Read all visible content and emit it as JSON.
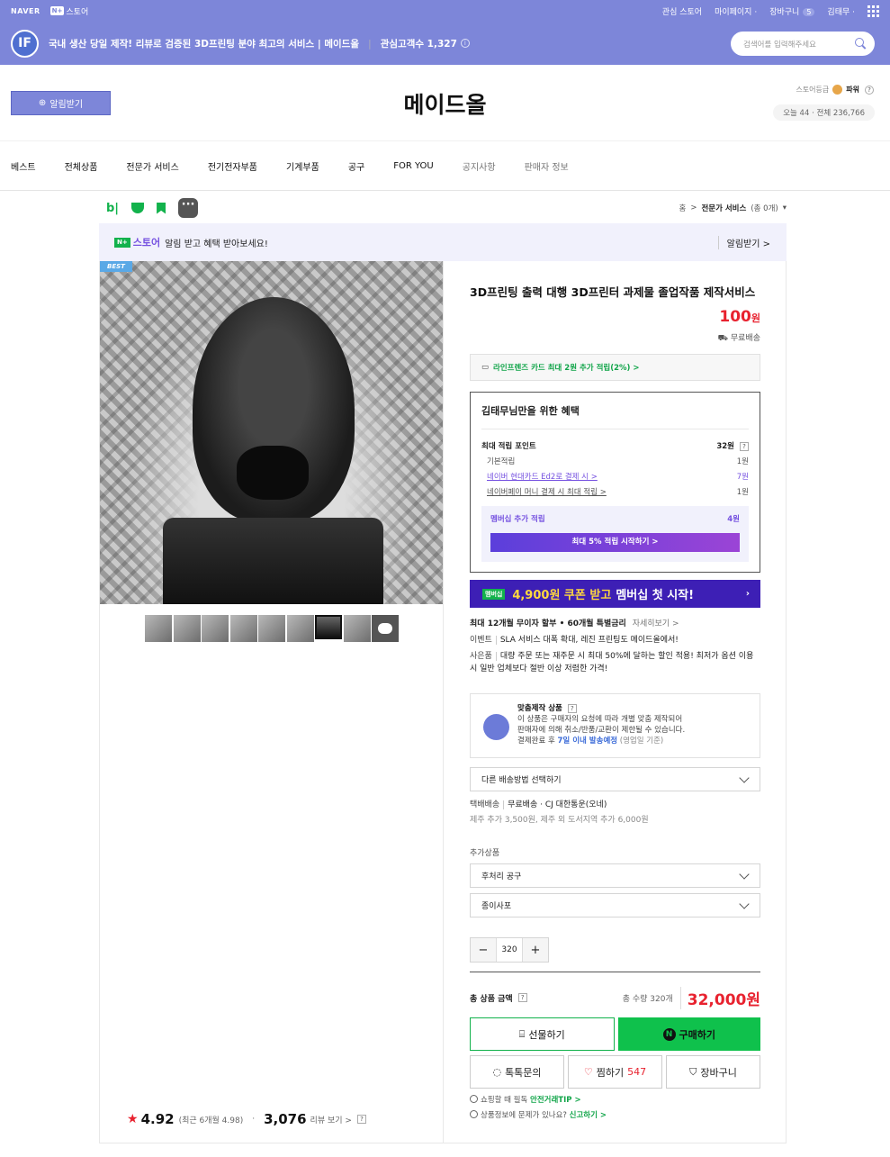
{
  "topbar": {
    "naver": "NAVER",
    "nplus": "스토어",
    "nbadge": "N+",
    "links": [
      "관심 스토어",
      "마이페이지",
      "장바구니",
      "김태무"
    ],
    "cart_count": "5"
  },
  "banner": {
    "logo": "IF",
    "title": "국내 생산 당일 제작! 리뷰로 검증된 3D프린팅 분야 최고의 서비스 | 메이드올",
    "followers": "관심고객수 1,327",
    "search_placeholder": "검색어를 입력해주세요"
  },
  "store": {
    "alarm_label": "알림받기",
    "name": "메이드올",
    "grade_label": "스토어등급",
    "grade": "파워",
    "today": "오늘 44",
    "total": "전체 236,766"
  },
  "nav": {
    "items": [
      "베스트",
      "전체상품",
      "전문가 서비스",
      "전기전자부품",
      "기계부품",
      "공구",
      "FOR YOU",
      "공지사항",
      "판매자 정보"
    ]
  },
  "crumb": {
    "home": "홈",
    "current": "전문가 서비스",
    "count": "(총 0개)"
  },
  "notice": {
    "brand": "스토어",
    "message": "알림 받고 혜택 받아보세요!",
    "action": "알림받기 >"
  },
  "gallery": {
    "badge": "BEST"
  },
  "rating": {
    "score": "4.92",
    "recent": "(최근 6개월 4.98)",
    "reviews": "3,076",
    "reviews_label": "리뷰 보기 >"
  },
  "product": {
    "title": "3D프린팅 출력 대행 3D프린터 과제물 졸업작품 제작서비스",
    "price": "100",
    "price_unit": "원",
    "shipping": "무료배송",
    "card_promo": "라인프렌즈 카드 최대 2원 추가 적립(2%) >"
  },
  "benefit": {
    "title": "김태무님만을 위한 혜택",
    "max_label": "최대 적립 포인트",
    "max_value": "32원",
    "rows": [
      {
        "label": "기본적립",
        "value": "1원"
      },
      {
        "label": "네이버 현대카드 Ed2로 결제 시 >",
        "value": "7원"
      },
      {
        "label": "네이버페이 머니 결제 시 최대 적립 >",
        "value": "1원"
      }
    ],
    "member_label": "멤버십 추가 적립",
    "member_value": "4원",
    "member_btn": "최대 5% 적립 시작하기 >"
  },
  "coupon": {
    "tag": "멤버십",
    "highlight": "4,900원 쿠폰 받고",
    "rest": "멤버십 첫 시작!"
  },
  "info": {
    "installment": "최대 12개월 무이자 할부 • 60개월 특별금리",
    "installment_more": "자세히보기 >",
    "event_label": "이벤트",
    "event": "SLA 서비스 대폭 확대, 레진 프린팅도 메이드올에서!",
    "gift_label": "사은품",
    "gift": "대량 주문 또는 재주문 시 최대 50%에 달하는 할인 적용! 최저가 옵션 이용시 일반 업체보다 절반 이상 저렴한 가격!"
  },
  "custom": {
    "title": "맞춤제작 상품",
    "line1": "이 상품은 구매자의 요청에 따라 개별 맞춤 제작되어",
    "line2": "판매자에 의해 취소/반품/교환이 제한될 수 있습니다.",
    "line3_pre": "결제완료 후",
    "line3_hl": "7일 이내 발송예정",
    "line3_post": "(영업일 기준)"
  },
  "delivery": {
    "select": "다른 배송방법 선택하기",
    "type": "택배배송",
    "desc": "무료배송 · CJ 대한통운(오네)",
    "extra": "제주 추가 3,500원, 제주 외 도서지역 추가 6,000원"
  },
  "addon": {
    "label": "추가상품",
    "options": [
      "후처리 공구",
      "종이사포"
    ]
  },
  "quantity": {
    "value": "320"
  },
  "total": {
    "label": "총 상품 금액",
    "qty": "총 수량 320개",
    "amount": "32,000원"
  },
  "actions": {
    "gift": "선물하기",
    "buy": "구매하기",
    "talk": "톡톡문의",
    "wish": "찜하기",
    "wish_count": "547",
    "cart": "장바구니"
  },
  "footer": {
    "safety": "쇼핑할 때 필독",
    "safety_link": "안전거래TIP >",
    "report": "상품정보에 문제가 있나요?",
    "report_link": "신고하기 >"
  },
  "colors": {
    "brand": "#7d86d9",
    "green": "#0fc14c",
    "price": "#e8222f",
    "purple": "#7551e0"
  }
}
